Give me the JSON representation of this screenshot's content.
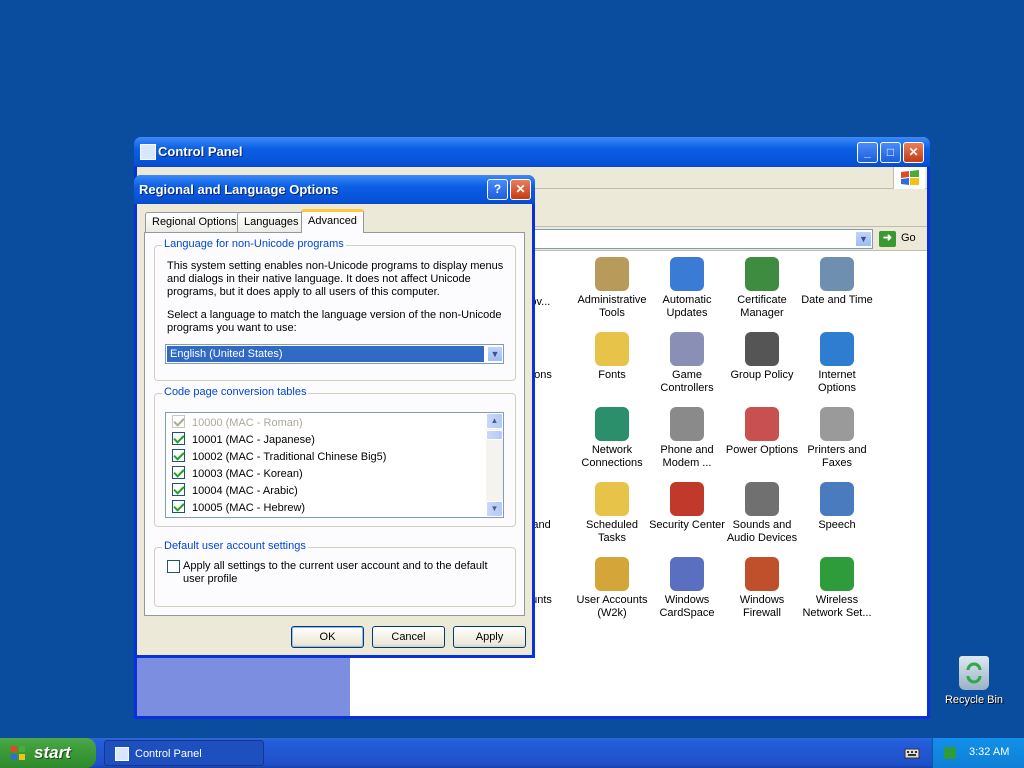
{
  "control_panel": {
    "title": "Control Panel",
    "go_label": "Go",
    "items": [
      {
        "label": "Administrative Tools",
        "icon": "admin-tools-icon",
        "color": "#b89a5a"
      },
      {
        "label": "Automatic Updates",
        "icon": "windows-update-icon",
        "color": "#3a7bd5"
      },
      {
        "label": "Certificate Manager",
        "icon": "certificate-icon",
        "color": "#3d8c40"
      },
      {
        "label": "Date and Time",
        "icon": "clock-icon",
        "color": "#6e8fb0"
      },
      {
        "label": "Fonts",
        "icon": "fonts-folder-icon",
        "color": "#e8c34a"
      },
      {
        "label": "Game Controllers",
        "icon": "gamepad-icon",
        "color": "#8a8fb5"
      },
      {
        "label": "Group Policy",
        "icon": "group-policy-icon",
        "color": "#555555"
      },
      {
        "label": "Internet Options",
        "icon": "globe-icon",
        "color": "#2e7dd1"
      },
      {
        "label": "Network Connections",
        "icon": "network-icon",
        "color": "#2a8f6a"
      },
      {
        "label": "Phone and Modem ...",
        "icon": "phone-icon",
        "color": "#8a8a8a"
      },
      {
        "label": "Power Options",
        "icon": "power-icon",
        "color": "#c85050"
      },
      {
        "label": "Printers and Faxes",
        "icon": "printer-icon",
        "color": "#9a9a9a"
      },
      {
        "label": "Scheduled Tasks",
        "icon": "scheduled-tasks-icon",
        "color": "#e8c34a"
      },
      {
        "label": "Security Center",
        "icon": "shield-icon",
        "color": "#c0392b"
      },
      {
        "label": "Sounds and Audio Devices",
        "icon": "speaker-icon",
        "color": "#707070"
      },
      {
        "label": "Speech",
        "icon": "speech-icon",
        "color": "#4a7bbf"
      },
      {
        "label": "User Accounts (W2k)",
        "icon": "user-accounts-icon",
        "color": "#d4a63a"
      },
      {
        "label": "Windows CardSpace",
        "icon": "cardspace-icon",
        "color": "#5a6fbf"
      },
      {
        "label": "Windows Firewall",
        "icon": "firewall-icon",
        "color": "#c0502c"
      },
      {
        "label": "Wireless Network Set...",
        "icon": "wireless-icon",
        "color": "#2e9c3a"
      }
    ],
    "partial_items": [
      "l or\nov...",
      "Options",
      "use",
      "ers and\neras",
      "ccounts"
    ]
  },
  "dialog": {
    "title": "Regional and Language Options",
    "help_button": "?",
    "tabs": [
      {
        "label": "Regional Options",
        "selected": false
      },
      {
        "label": "Languages",
        "selected": false
      },
      {
        "label": "Advanced",
        "selected": true
      }
    ],
    "non_unicode": {
      "legend": "Language for non-Unicode programs",
      "description": "This system setting enables non-Unicode programs to display menus and dialogs in their native language. It does not affect Unicode programs, but it does apply to all users of this computer.",
      "instruction": "Select a language to match the language version of the non-Unicode programs you want to use:",
      "selected_language": "English (United States)"
    },
    "code_pages": {
      "legend": "Code page conversion tables",
      "items": [
        {
          "label": "10000 (MAC - Roman)",
          "checked": true,
          "disabled": true
        },
        {
          "label": "10001 (MAC - Japanese)",
          "checked": true,
          "disabled": false
        },
        {
          "label": "10002 (MAC - Traditional Chinese Big5)",
          "checked": true,
          "disabled": false
        },
        {
          "label": "10003 (MAC - Korean)",
          "checked": true,
          "disabled": false
        },
        {
          "label": "10004 (MAC - Arabic)",
          "checked": true,
          "disabled": false
        },
        {
          "label": "10005 (MAC - Hebrew)",
          "checked": true,
          "disabled": false
        }
      ]
    },
    "default_account": {
      "legend": "Default user account settings",
      "checkbox_label": "Apply all settings to the current user account and to the default user profile",
      "checked": false
    },
    "buttons": {
      "ok": "OK",
      "cancel": "Cancel",
      "apply": "Apply"
    }
  },
  "desktop": {
    "recycle_bin": "Recycle Bin"
  },
  "taskbar": {
    "start_label": "start",
    "task_label": "Control Panel",
    "clock": "3:32 AM"
  }
}
